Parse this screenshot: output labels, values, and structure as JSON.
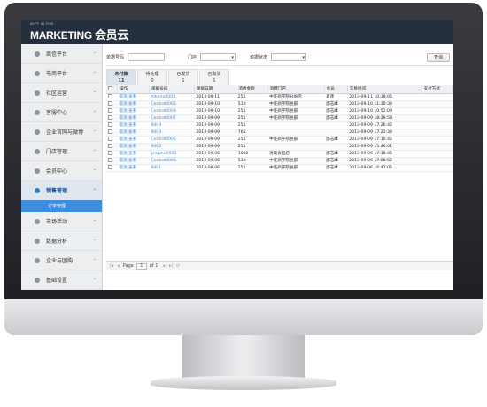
{
  "brand": {
    "tagline": "GIFT IN THE",
    "name": "MARKETING",
    "cn": "会员云"
  },
  "sidebar": {
    "items": [
      {
        "label": "商信平台"
      },
      {
        "label": "电商平台"
      },
      {
        "label": "社区运营"
      },
      {
        "label": "客服中心"
      },
      {
        "label": "企业官网与微博"
      },
      {
        "label": "门店管理"
      },
      {
        "label": "会员中心"
      },
      {
        "label": "销售管理",
        "active": true
      },
      {
        "label": "市场活动"
      },
      {
        "label": "数据分析"
      },
      {
        "label": "企业与团购"
      },
      {
        "label": "基础设置"
      }
    ],
    "sub": "订单管理"
  },
  "filters": {
    "order_no": "单据号码",
    "store": "门店",
    "status": "单据状态",
    "query": "查询"
  },
  "tabs": [
    {
      "label": "未付款",
      "count": "11"
    },
    {
      "label": "待处理",
      "count": "0"
    },
    {
      "label": "已发货",
      "count": "1"
    },
    {
      "label": "已取消",
      "count": "1"
    }
  ],
  "columns": [
    "操作",
    "单据号码",
    "单据日期",
    "消费金额",
    "消费门店",
    "会员",
    "交易时间",
    "支付方式"
  ],
  "rows": [
    {
      "ops": "取消 查看",
      "no": "Alluma0003",
      "date": "2013-09-11",
      "amt": "255",
      "store": "中旺商学院分站店",
      "member": "喜连",
      "time": "2013-09-11 10:38:05"
    },
    {
      "ops": "取消 查看",
      "no": "Central0002",
      "date": "2013-09-10",
      "amt": "510",
      "store": "中旺商学院总部",
      "member": "邵志峰",
      "time": "2013-09-10 11:30:34"
    },
    {
      "ops": "取消 查看",
      "no": "Central0008",
      "date": "2013-09-10",
      "amt": "255",
      "store": "中旺商学院总部",
      "member": "邵志峰",
      "time": "2013-09-10 10:51:09"
    },
    {
      "ops": "取消 查看",
      "no": "Central0007",
      "date": "2013-09-09",
      "amt": "255",
      "store": "中旺商学院总部",
      "member": "邵志峰",
      "time": "2013-09-09 18:29:58"
    },
    {
      "ops": "取消 查看",
      "no": "0004",
      "date": "2013-09-09",
      "amt": "255",
      "store": "",
      "member": "",
      "time": "2013-09-09 17:26:42"
    },
    {
      "ops": "取消 查看",
      "no": "0003",
      "date": "2013-09-09",
      "amt": "765",
      "store": "",
      "member": "",
      "time": "2013-09-09 17:21:34"
    },
    {
      "ops": "取消 查看",
      "no": "Central0006",
      "date": "2013-09-09",
      "amt": "255",
      "store": "中旺商学院总部",
      "member": "邵志峰",
      "time": "2013-09-09 17:10:42"
    },
    {
      "ops": "取消 查看",
      "no": "0002",
      "date": "2013-09-09",
      "amt": "255",
      "store": "",
      "member": "",
      "time": "2013-09-09 15:46:01"
    },
    {
      "ops": "取消 查看",
      "no": "yingme0003",
      "date": "2013-09-06",
      "amt": "1020",
      "store": "清美食品店",
      "member": "邵志峰",
      "time": "2013-09-06 17:18:45"
    },
    {
      "ops": "取消 查看",
      "no": "Central0005",
      "date": "2013-09-06",
      "amt": "510",
      "store": "中旺商学院总部",
      "member": "邵志峰",
      "time": "2013-09-06 17:08:52"
    },
    {
      "ops": "取消 查看",
      "no": "0001",
      "date": "2013-09-06",
      "amt": "255",
      "store": "中旺商学院总部",
      "member": "邵志峰",
      "time": "2013-09-06 16:47:05"
    }
  ],
  "pager": {
    "page_label": "Page",
    "page": "1",
    "of": "of 1"
  }
}
